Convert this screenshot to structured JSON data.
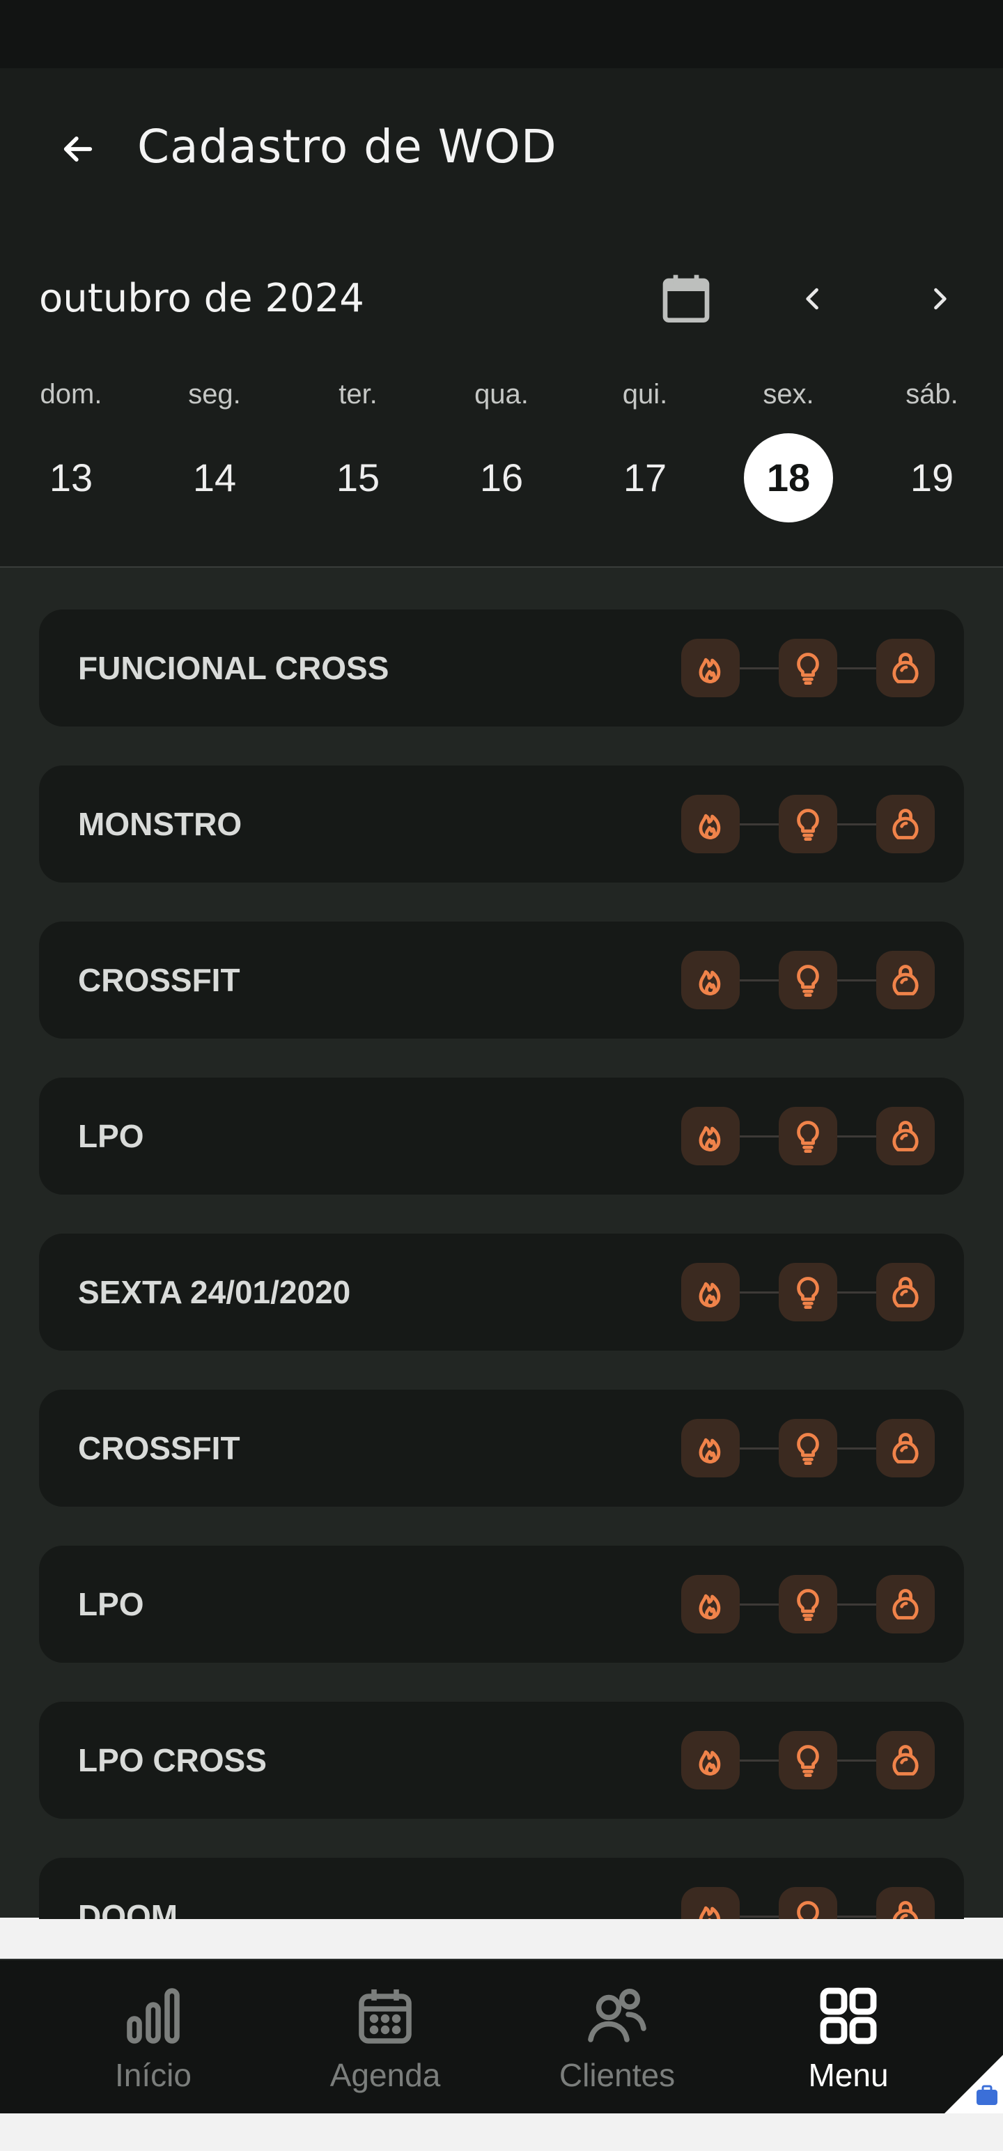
{
  "header": {
    "title": "Cadastro de WOD",
    "month_label": "outubro de 2024"
  },
  "week": [
    {
      "name": "dom.",
      "num": "13"
    },
    {
      "name": "seg.",
      "num": "14"
    },
    {
      "name": "ter.",
      "num": "15"
    },
    {
      "name": "qua.",
      "num": "16"
    },
    {
      "name": "qui.",
      "num": "17"
    },
    {
      "name": "sex.",
      "num": "18",
      "selected": true
    },
    {
      "name": "sáb.",
      "num": "19"
    }
  ],
  "wods": [
    {
      "name": "FUNCIONAL CROSS"
    },
    {
      "name": "MONSTRO"
    },
    {
      "name": "CROSSFIT"
    },
    {
      "name": "LPO"
    },
    {
      "name": "SEXTA 24/01/2020"
    },
    {
      "name": "CROSSFIT"
    },
    {
      "name": "LPO"
    },
    {
      "name": "LPO CROSS"
    },
    {
      "name": "DOOM"
    }
  ],
  "step_icons": [
    "flame-icon",
    "lightbulb-icon",
    "kettlebell-icon"
  ],
  "nav": [
    {
      "label": "Início",
      "icon": "bar-chart-icon"
    },
    {
      "label": "Agenda",
      "icon": "calendar-icon"
    },
    {
      "label": "Clientes",
      "icon": "users-icon"
    },
    {
      "label": "Menu",
      "icon": "grid-icon",
      "active": true
    }
  ],
  "colors": {
    "accent": "#f0834a",
    "step_bg": "#3b2a20",
    "card_bg": "#161917",
    "list_bg": "#222623",
    "header_bg": "#1a1d1b"
  }
}
